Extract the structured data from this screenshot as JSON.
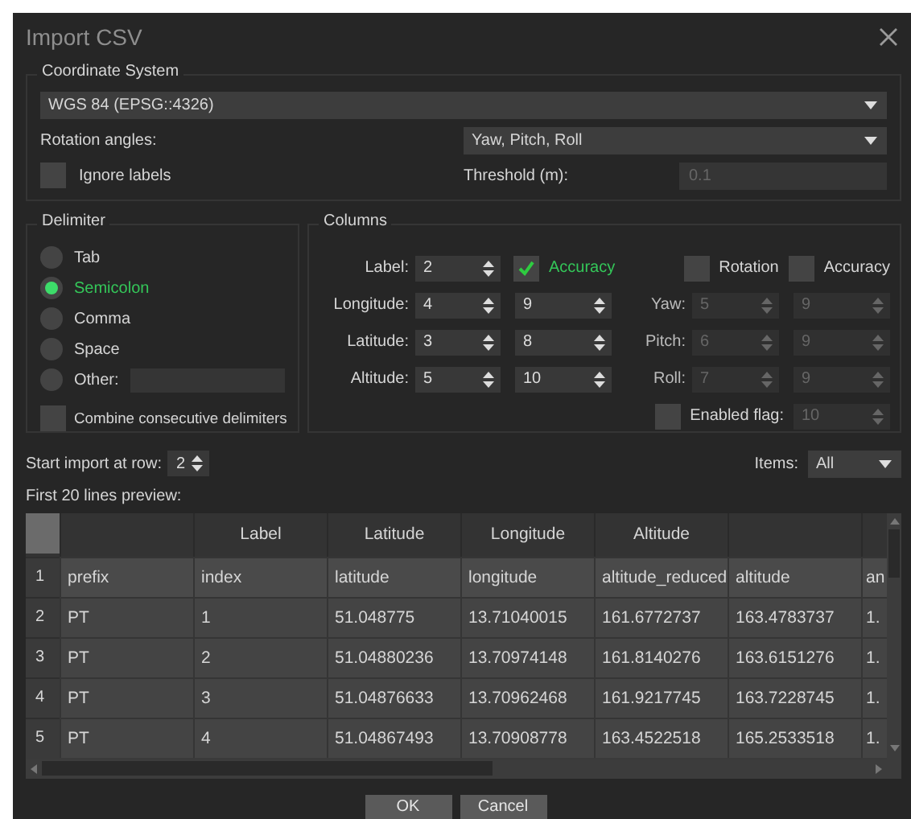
{
  "window": {
    "title": "Import CSV"
  },
  "coordinate_system": {
    "title": "Coordinate System",
    "value": "WGS 84 (EPSG::4326)",
    "rotation_label": "Rotation angles:",
    "rotation_value": "Yaw, Pitch, Roll",
    "ignore_labels": {
      "label": "Ignore labels",
      "checked": false
    },
    "threshold_label": "Threshold (m):",
    "threshold_value": "0.1",
    "threshold_disabled": true
  },
  "delimiter": {
    "title": "Delimiter",
    "options": [
      {
        "label": "Tab",
        "selected": false,
        "kind": "radio"
      },
      {
        "label": "Semicolon",
        "selected": true,
        "kind": "radio"
      },
      {
        "label": "Comma",
        "selected": false,
        "kind": "radio"
      },
      {
        "label": "Space",
        "selected": false,
        "kind": "radio"
      },
      {
        "label": "Other:",
        "selected": false,
        "kind": "other"
      }
    ],
    "combine": {
      "label": "Combine consecutive delimiters",
      "checked": false
    }
  },
  "columns": {
    "title": "Columns",
    "accuracy": {
      "label": "Accuracy",
      "checked": true
    },
    "position_rows": [
      {
        "label": "Label:",
        "value": "2"
      },
      {
        "label": "Longitude:",
        "value": "4",
        "accuracy": "9"
      },
      {
        "label": "Latitude:",
        "value": "3",
        "accuracy": "8"
      },
      {
        "label": "Altitude:",
        "value": "5",
        "accuracy": "10"
      }
    ],
    "rotation": {
      "label": "Rotation",
      "checked": false
    },
    "rotation_accuracy": {
      "label": "Accuracy",
      "checked": false
    },
    "rotation_disabled": true,
    "rotation_rows": [
      {
        "label": "Yaw:",
        "value": "5",
        "accuracy": "9"
      },
      {
        "label": "Pitch:",
        "value": "6",
        "accuracy": "9"
      },
      {
        "label": "Roll:",
        "value": "7",
        "accuracy": "9"
      }
    ],
    "enabled_flag": {
      "label": "Enabled flag:",
      "checked": false,
      "value": "10"
    }
  },
  "start_row": {
    "label": "Start import at row:",
    "value": "2"
  },
  "items": {
    "label": "Items:",
    "value": "All"
  },
  "preview_label": "First 20 lines preview:",
  "table": {
    "columns": [
      {},
      {
        "heading": "Label"
      },
      {
        "heading": "Latitude"
      },
      {
        "heading": "Longitude"
      },
      {
        "heading": "Altitude"
      },
      {},
      {}
    ],
    "rows": [
      {
        "number": "1",
        "cells": [
          "prefix",
          "index",
          "latitude",
          "longitude",
          "altitude_reduced",
          "altitude",
          "an"
        ]
      },
      {
        "number": "2",
        "cells": [
          "PT",
          "1",
          "51.048775",
          "13.71040015",
          "161.6772737",
          "163.4783737",
          "1."
        ]
      },
      {
        "number": "3",
        "cells": [
          "PT",
          "2",
          "51.04880236",
          "13.70974148",
          "161.8140276",
          "163.6151276",
          "1."
        ]
      },
      {
        "number": "4",
        "cells": [
          "PT",
          "3",
          "51.04876633",
          "13.70962468",
          "161.9217745",
          "163.7228745",
          "1."
        ]
      },
      {
        "number": "5",
        "cells": [
          "PT",
          "4",
          "51.04867493",
          "13.70908778",
          "163.4522518",
          "165.2533518",
          "1."
        ]
      }
    ]
  },
  "buttons": [
    "OK",
    "Cancel"
  ]
}
